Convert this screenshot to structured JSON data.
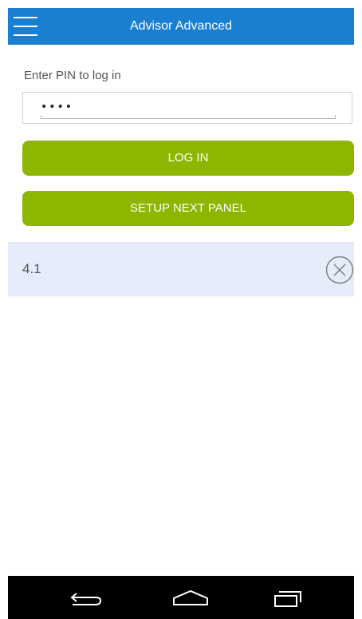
{
  "app_bar": {
    "title": "Advisor Advanced",
    "menu_icon": "hamburger-menu-icon",
    "color": "#1a7fd0"
  },
  "login": {
    "pin_label": "Enter PIN to log in",
    "pin_value": "••••",
    "login_label": "LOG IN",
    "setup_label": "SETUP NEXT PANEL",
    "button_color": "#8db600"
  },
  "panels": [
    {
      "name": "4.1",
      "remove_icon": "close-circle-icon"
    }
  ],
  "nav_bar": {
    "icons": [
      "back-icon",
      "home-icon",
      "recent-apps-icon"
    ]
  }
}
